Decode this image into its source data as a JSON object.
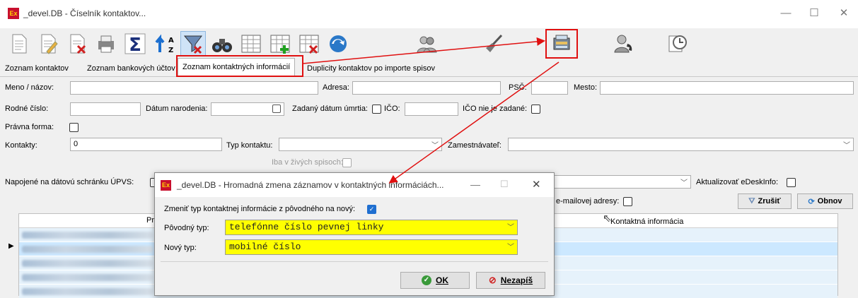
{
  "window": {
    "title": "_devel.DB - Číselník kontaktov...",
    "app_icon": "Ex",
    "minimize": "—",
    "maximize": "☐",
    "close": "✕"
  },
  "toolbar": {
    "icons": [
      "document-icon",
      "edit-document-icon",
      "delete-document-icon",
      "print-icon",
      "sum-icon",
      "sort-az-icon",
      "filter-clear-icon",
      "binoculars-icon",
      "grid-icon",
      "grid-add-icon",
      "grid-delete-icon",
      "refresh-icon",
      "users-icon",
      "broom-icon",
      "bulk-edit-icon",
      "user-phone-icon",
      "clock-icon"
    ]
  },
  "tabs": [
    {
      "label": "Zoznam kontaktov"
    },
    {
      "label": "Zoznam bankových účtov"
    },
    {
      "label": "Zoznam kontaktných informácií"
    },
    {
      "label": "Duplicity kontaktov po importe spisov"
    }
  ],
  "filters": {
    "name_label": "Meno / názov:",
    "address_label": "Adresa:",
    "psc_label": "PSČ:",
    "city_label": "Mesto:",
    "birth_number_label": "Rodné číslo:",
    "birth_date_label": "Dátum narodenia:",
    "death_date_label": "Zadaný dátum úmrtia:",
    "ico_label": "IČO:",
    "ico_not_set_label": "IČO nie je zadané:",
    "legal_form_label": "Právna forma:",
    "contacts_label": "Kontakty:",
    "contacts_value": "0",
    "contact_type_label": "Typ kontaktu:",
    "employer_label": "Zamestnávateľ:",
    "only_living_label": "Iba v živých spisoch:",
    "upvs_label": "Napojené na dátovú schránku ÚPVS:",
    "edesk_label": "Aktualizovať eDeskInfo:",
    "email_label": "e-mailovej adresy:",
    "cancel_btn": "Zrušiť",
    "refresh_btn": "Obnov"
  },
  "grid": {
    "col_assigned": "Priradené",
    "col_contact_info": "Kontaktná informácia"
  },
  "dialog": {
    "title": "_devel.DB - Hromadná zmena záznamov v kontaktných informáciách...",
    "change_type_label": "Zmeniť typ kontaktnej informácie z pôvodného na nový:",
    "change_type_checked": true,
    "original_type_label": "Pôvodný typ:",
    "original_type_value": "telefónne číslo pevnej linky",
    "new_type_label": "Nový typ:",
    "new_type_value": "mobilné číslo",
    "ok_label": "OK",
    "cancel_label": "Nezapíš"
  },
  "colors": {
    "annotation_red": "#e01010",
    "highlight_yellow": "#ffff00",
    "selection_blue": "#cce8ff",
    "grid_row_tint": "#e6f2fb"
  }
}
